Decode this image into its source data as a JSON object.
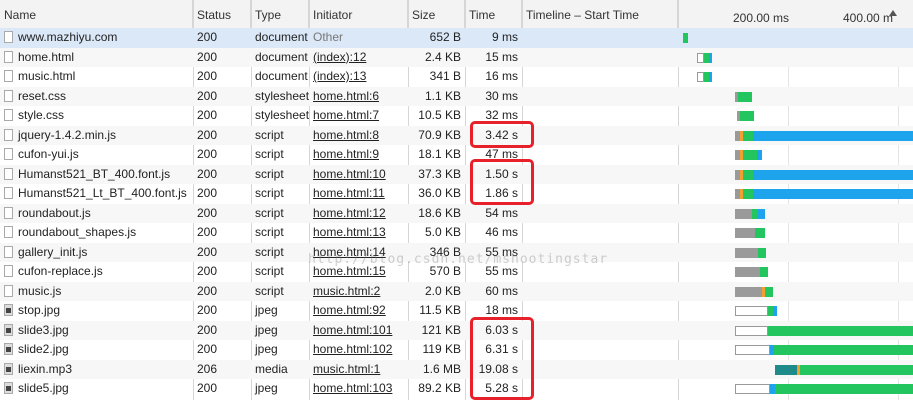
{
  "columns": {
    "name": "Name",
    "status": "Status",
    "type": "Type",
    "initiator": "Initiator",
    "size": "Size",
    "time": "Time",
    "timeline": "Timeline – Start Time",
    "tick1": "200.00 ms",
    "tick2": "400.00 m"
  },
  "rows": [
    {
      "name": "www.mazhiyu.com",
      "status": "200",
      "type": "document",
      "initiator": "Other",
      "size": "652 B",
      "time": "9 ms"
    },
    {
      "name": "home.html",
      "status": "200",
      "type": "document",
      "initiator": "(index):12",
      "size": "2.4 KB",
      "time": "15 ms"
    },
    {
      "name": "music.html",
      "status": "200",
      "type": "document",
      "initiator": "(index):13",
      "size": "341 B",
      "time": "16 ms"
    },
    {
      "name": "reset.css",
      "status": "200",
      "type": "stylesheet",
      "initiator": "home.html:6",
      "size": "1.1 KB",
      "time": "30 ms"
    },
    {
      "name": "style.css",
      "status": "200",
      "type": "stylesheet",
      "initiator": "home.html:7",
      "size": "10.5 KB",
      "time": "32 ms"
    },
    {
      "name": "jquery-1.4.2.min.js",
      "status": "200",
      "type": "script",
      "initiator": "home.html:8",
      "size": "70.9 KB",
      "time": "3.42 s"
    },
    {
      "name": "cufon-yui.js",
      "status": "200",
      "type": "script",
      "initiator": "home.html:9",
      "size": "18.1 KB",
      "time": "47 ms"
    },
    {
      "name": "Humanst521_BT_400.font.js",
      "status": "200",
      "type": "script",
      "initiator": "home.html:10",
      "size": "37.3 KB",
      "time": "1.50 s"
    },
    {
      "name": "Humanst521_Lt_BT_400.font.js",
      "status": "200",
      "type": "script",
      "initiator": "home.html:11",
      "size": "36.0 KB",
      "time": "1.86 s"
    },
    {
      "name": "roundabout.js",
      "status": "200",
      "type": "script",
      "initiator": "home.html:12",
      "size": "18.6 KB",
      "time": "54 ms"
    },
    {
      "name": "roundabout_shapes.js",
      "status": "200",
      "type": "script",
      "initiator": "home.html:13",
      "size": "5.0 KB",
      "time": "46 ms"
    },
    {
      "name": "gallery_init.js",
      "status": "200",
      "type": "script",
      "initiator": "home.html:14",
      "size": "346 B",
      "time": "55 ms"
    },
    {
      "name": "cufon-replace.js",
      "status": "200",
      "type": "script",
      "initiator": "home.html:15",
      "size": "570 B",
      "time": "55 ms"
    },
    {
      "name": "music.js",
      "status": "200",
      "type": "script",
      "initiator": "music.html:2",
      "size": "2.0 KB",
      "time": "60 ms"
    },
    {
      "name": "stop.jpg",
      "status": "200",
      "type": "jpeg",
      "initiator": "home.html:92",
      "size": "11.5 KB",
      "time": "18 ms"
    },
    {
      "name": "slide3.jpg",
      "status": "200",
      "type": "jpeg",
      "initiator": "home.html:101",
      "size": "121 KB",
      "time": "6.03 s"
    },
    {
      "name": "slide2.jpg",
      "status": "200",
      "type": "jpeg",
      "initiator": "home.html:102",
      "size": "119 KB",
      "time": "6.31 s"
    },
    {
      "name": "liexin.mp3",
      "status": "206",
      "type": "media",
      "initiator": "music.html:1",
      "size": "1.6 MB",
      "time": "19.08 s"
    },
    {
      "name": "slide5.jpg",
      "status": "200",
      "type": "jpeg",
      "initiator": "home.html:103",
      "size": "89.2 KB",
      "time": "5.28 s"
    }
  ],
  "watermark": "http://blog.csdn.net/mshootingstar",
  "colors": {
    "header_bg": "#f3f3f3",
    "selected_row": "#dbe8f8",
    "annotation_red": "#e8202a",
    "waiting_green": "#22c55e",
    "download_blue": "#1ea4ec",
    "queue_gray": "#9a9a9a",
    "ssl_orange": "#f0a030"
  }
}
